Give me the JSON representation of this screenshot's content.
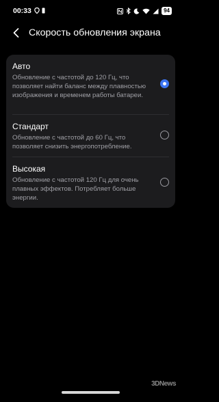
{
  "status_bar": {
    "time": "00:33",
    "battery": "94"
  },
  "header": {
    "title": "Скорость обновления экрана"
  },
  "options": [
    {
      "title": "Авто",
      "description": "Обновление с частотой до 120 Гц, что позволяет найти баланс между плавностью изображения и временем работы батареи.",
      "selected": true
    },
    {
      "title": "Стандарт",
      "description": "Обновление с частотой до 60 Гц, что позволяет снизить энергопотребление.",
      "selected": false
    },
    {
      "title": "Высокая",
      "description": "Обновление с частотой 120 Гц для очень плавных эффектов. Потребляет больше энергии.",
      "selected": false
    }
  ],
  "watermark": {
    "text": "3DNews"
  },
  "colors": {
    "accent": "#3d75f2",
    "card_background": "#1c1c1e",
    "page_background": "#000000"
  }
}
